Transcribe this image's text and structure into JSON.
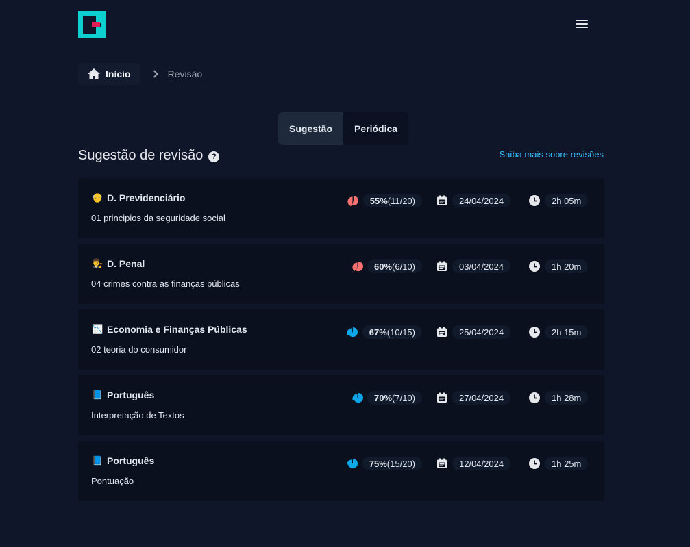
{
  "breadcrumb": {
    "home_label": "Início",
    "current_label": "Revisão"
  },
  "tabs": [
    {
      "label": "Sugestão",
      "active": true
    },
    {
      "label": "Periódica",
      "active": false
    }
  ],
  "section": {
    "title": "Sugestão de revisão",
    "help_symbol": "?",
    "link_label": "Saiba mais sobre revisões"
  },
  "colors": {
    "accent_teal": "#0ecfcf",
    "accent_pink": "#e21c56",
    "low_progress": "#f87171",
    "high_progress": "#0ea5e9",
    "link": "#38bdf8"
  },
  "reviews": [
    {
      "emoji": "👴",
      "subject": "D. Previdenciário",
      "topic": "01 principios da seguridade social",
      "percent": "55%",
      "count": "(11/20)",
      "progress": 0.55,
      "chart_color": "#f87171",
      "date": "24/04/2024",
      "time": "2h 05m"
    },
    {
      "emoji": "👨‍⚖️",
      "subject": "D. Penal",
      "topic": "04 crimes contra as finanças públicas",
      "percent": "60%",
      "count": "(6/10)",
      "progress": 0.6,
      "chart_color": "#f87171",
      "date": "03/04/2024",
      "time": "1h 20m"
    },
    {
      "emoji": "📉",
      "subject": "Economia e Finanças Públicas",
      "topic": "02 teoria do consumidor",
      "percent": "67%",
      "count": "(10/15)",
      "progress": 0.67,
      "chart_color": "#0ea5e9",
      "date": "25/04/2024",
      "time": "2h 15m"
    },
    {
      "emoji": "📘",
      "subject": "Português",
      "topic": "Interpretação de Textos",
      "percent": "70%",
      "count": "(7/10)",
      "progress": 0.7,
      "chart_color": "#0ea5e9",
      "date": "27/04/2024",
      "time": "1h 28m"
    },
    {
      "emoji": "📘",
      "subject": "Português",
      "topic": "Pontuação",
      "percent": "75%",
      "count": "(15/20)",
      "progress": 0.75,
      "chart_color": "#0ea5e9",
      "date": "12/04/2024",
      "time": "1h 25m"
    }
  ]
}
